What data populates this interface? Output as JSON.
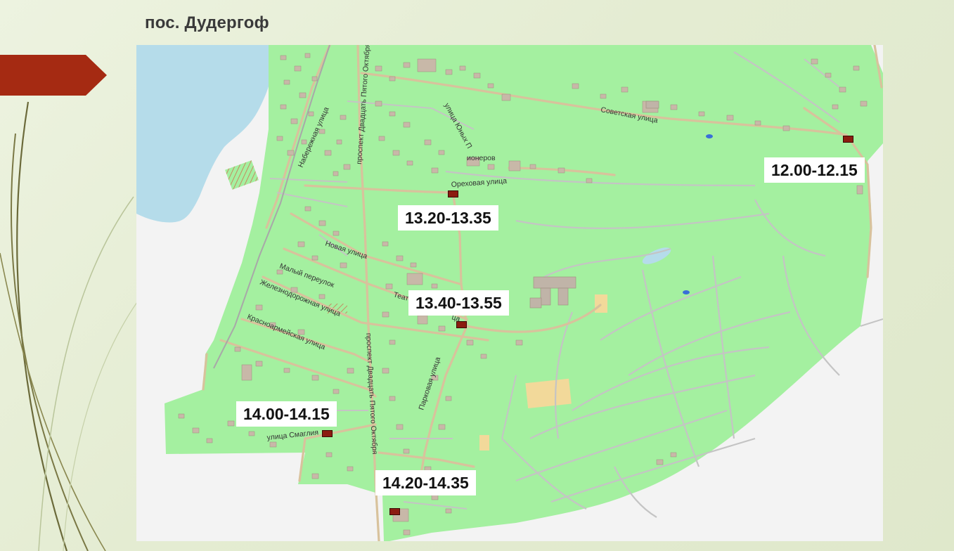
{
  "slide": {
    "title": "пос. Дудергоф"
  },
  "colors": {
    "land": "#a4f0a0",
    "water": "#b5dcea",
    "road": "#d8c29c",
    "path": "#c4c4c4",
    "building": "#c8b8a8",
    "outside": "#f3f3f3",
    "marker": "#8b1c10",
    "banner": "#a52a12"
  },
  "streets": {
    "nab": "Набережная улица",
    "prospect_north": "проспект Двадцать Пятого Октября",
    "prospect_south": "проспект Двадцать Пятого Октября",
    "sovetskaya": "Советская улица",
    "yunykh_pionerov_a": "улица Юных П",
    "yunykh_pionerov_b": "ионеров",
    "orekhovaya": "Ореховая улица",
    "novaya": "Новая улица",
    "maly": "Малый переулок",
    "zheleznodorozhnaya": "Железнодорожная улица",
    "krasnoarmeyskaya": "Красноармейская улица",
    "teatr": "Теат",
    "teatr_tail": "ца",
    "parkovaya": "Парковая улица",
    "smaglia": "улица Смаглия"
  },
  "stops": [
    {
      "id": "stop-1",
      "time": "12.00-12.15"
    },
    {
      "id": "stop-2",
      "time": "13.20-13.35"
    },
    {
      "id": "stop-3",
      "time": "13.40-13.55"
    },
    {
      "id": "stop-4",
      "time": "14.00-14.15"
    },
    {
      "id": "stop-5",
      "time": "14.20-14.35"
    }
  ]
}
